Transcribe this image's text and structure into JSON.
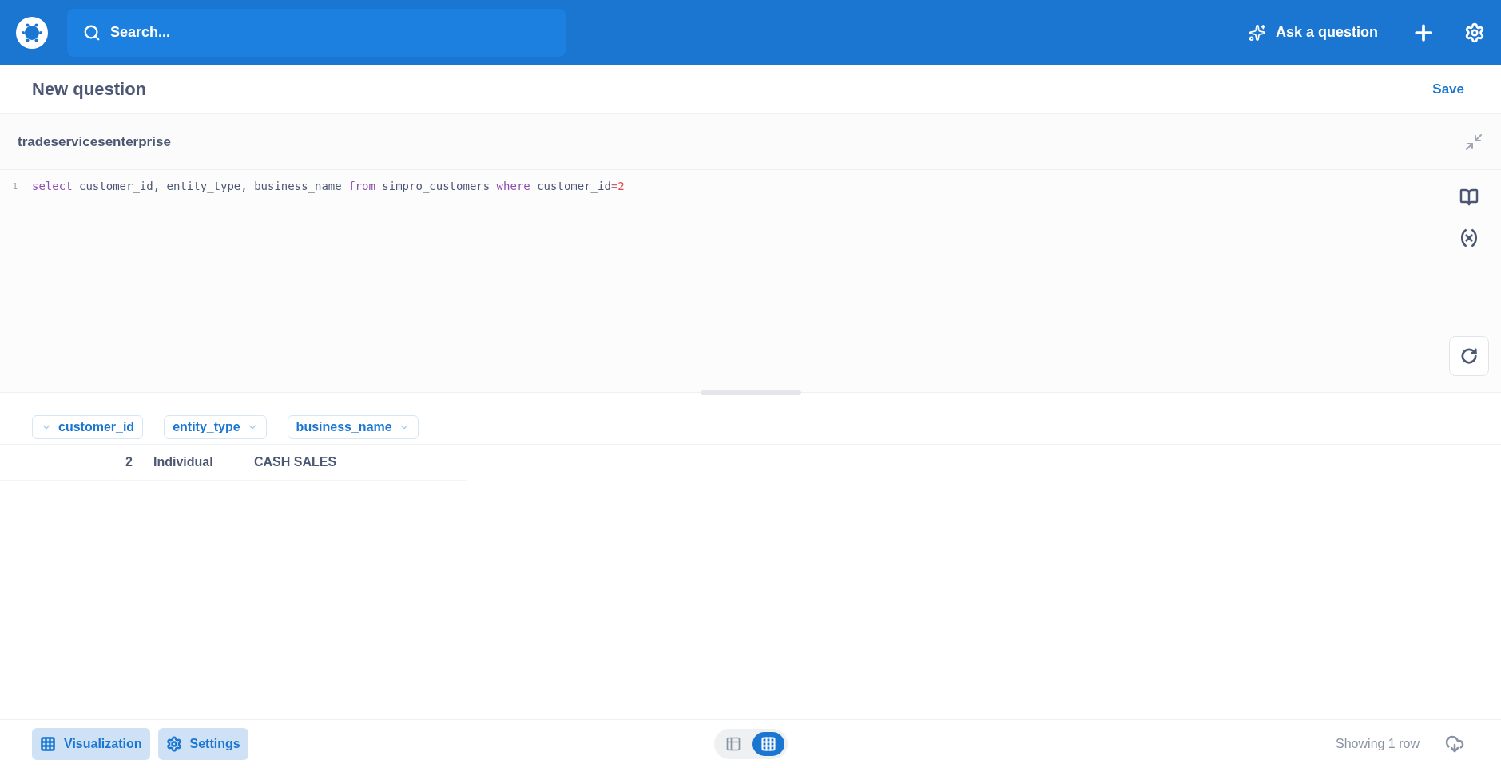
{
  "top_bar": {
    "search": {
      "placeholder": "Search..."
    },
    "ask_button": "Ask a question"
  },
  "header": {
    "title": "New question",
    "save": "Save"
  },
  "editor": {
    "database": "tradeservicesenterprise",
    "lines": [
      {
        "number": "1",
        "tokens": [
          {
            "kind": "keyword",
            "text": "select"
          },
          {
            "kind": "plain",
            "text": " customer_id, entity_type, business_name "
          },
          {
            "kind": "keyword",
            "text": "from"
          },
          {
            "kind": "plain",
            "text": " simpro_customers "
          },
          {
            "kind": "keyword",
            "text": "where"
          },
          {
            "kind": "plain",
            "text": " customer_id"
          },
          {
            "kind": "operator",
            "text": "="
          },
          {
            "kind": "number",
            "text": "2"
          }
        ]
      }
    ]
  },
  "table": {
    "columns": [
      {
        "label": "customer_id",
        "kind": "number"
      },
      {
        "label": "entity_type",
        "kind": "text"
      },
      {
        "label": "business_name",
        "kind": "text"
      }
    ],
    "rows": [
      [
        "2",
        "Individual",
        "CASH SALES"
      ]
    ]
  },
  "footer": {
    "visualization": "Visualization",
    "settings": "Settings",
    "views": [
      {
        "kind": "table",
        "selected": false
      },
      {
        "kind": "grid",
        "selected": true
      }
    ],
    "row_count": "Showing 1 row"
  }
}
